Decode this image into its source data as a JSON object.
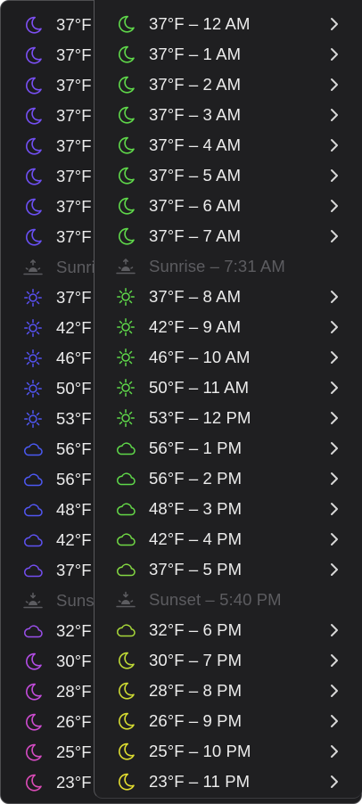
{
  "menu_back": {
    "rows": [
      {
        "icon": "moon-icon",
        "color": "#7d4ff2",
        "label": "37°F",
        "chevron": false,
        "info": false
      },
      {
        "icon": "moon-icon",
        "color": "#7a4ff2",
        "label": "37°F",
        "chevron": false,
        "info": false
      },
      {
        "icon": "moon-icon",
        "color": "#774ff2",
        "label": "37°F",
        "chevron": false,
        "info": false
      },
      {
        "icon": "moon-icon",
        "color": "#744ff2",
        "label": "37°F",
        "chevron": false,
        "info": false
      },
      {
        "icon": "moon-icon",
        "color": "#714ff2",
        "label": "37°F",
        "chevron": false,
        "info": false
      },
      {
        "icon": "moon-icon",
        "color": "#6e4ff2",
        "label": "37°F",
        "chevron": false,
        "info": false
      },
      {
        "icon": "moon-icon",
        "color": "#6b4ff2",
        "label": "37°F",
        "chevron": false,
        "info": false
      },
      {
        "icon": "moon-icon",
        "color": "#684ff2",
        "label": "37°F",
        "chevron": false,
        "info": false
      },
      {
        "icon": "sunrise-icon",
        "color": "#5c5c60",
        "label": "Sunris",
        "chevron": false,
        "info": true
      },
      {
        "icon": "sun-icon",
        "color": "#5a50f2",
        "label": "37°F",
        "chevron": false,
        "info": false
      },
      {
        "icon": "sun-icon",
        "color": "#5752f2",
        "label": "42°F",
        "chevron": false,
        "info": false
      },
      {
        "icon": "sun-icon",
        "color": "#5453f2",
        "label": "46°F",
        "chevron": false,
        "info": false
      },
      {
        "icon": "sun-icon",
        "color": "#5155f2",
        "label": "50°F",
        "chevron": false,
        "info": false
      },
      {
        "icon": "sun-icon",
        "color": "#4f57f2",
        "label": "53°F",
        "chevron": false,
        "info": false
      },
      {
        "icon": "cloud-icon",
        "color": "#4a59f2",
        "label": "56°F",
        "chevron": false,
        "info": false
      },
      {
        "icon": "cloud-icon",
        "color": "#4d58f2",
        "label": "56°F",
        "chevron": false,
        "info": false
      },
      {
        "icon": "cloud-icon",
        "color": "#5256f2",
        "label": "48°F",
        "chevron": false,
        "info": false
      },
      {
        "icon": "cloud-icon",
        "color": "#5e52f2",
        "label": "42°F",
        "chevron": false,
        "info": false
      },
      {
        "icon": "cloud-icon",
        "color": "#744ef0",
        "label": "37°F",
        "chevron": false,
        "info": false
      },
      {
        "icon": "sunset-icon",
        "color": "#5c5c60",
        "label": "Suns",
        "chevron": false,
        "info": true
      },
      {
        "icon": "cloud-icon",
        "color": "#9a4fea",
        "label": "32°F",
        "chevron": false,
        "info": false
      },
      {
        "icon": "moon-icon",
        "color": "#b24ce4",
        "label": "30°F",
        "chevron": false,
        "info": false
      },
      {
        "icon": "moon-icon",
        "color": "#c24bda",
        "label": "28°F",
        "chevron": false,
        "info": false
      },
      {
        "icon": "moon-icon",
        "color": "#cc4bce",
        "label": "26°F",
        "chevron": false,
        "info": false
      },
      {
        "icon": "moon-icon",
        "color": "#d44bc2",
        "label": "25°F",
        "chevron": false,
        "info": false
      },
      {
        "icon": "moon-icon",
        "color": "#da4bb6",
        "label": "23°F",
        "chevron": false,
        "info": false
      }
    ]
  },
  "menu_front": {
    "rows": [
      {
        "icon": "moon-icon",
        "color": "#5fd84a",
        "label": "37°F – 12 AM",
        "chevron": true,
        "info": false
      },
      {
        "icon": "moon-icon",
        "color": "#5fd84a",
        "label": "37°F – 1 AM",
        "chevron": true,
        "info": false
      },
      {
        "icon": "moon-icon",
        "color": "#5fd84a",
        "label": "37°F – 2 AM",
        "chevron": true,
        "info": false
      },
      {
        "icon": "moon-icon",
        "color": "#5fd84a",
        "label": "37°F – 3 AM",
        "chevron": true,
        "info": false
      },
      {
        "icon": "moon-icon",
        "color": "#5fd84a",
        "label": "37°F – 4 AM",
        "chevron": true,
        "info": false
      },
      {
        "icon": "moon-icon",
        "color": "#5fd84a",
        "label": "37°F – 5 AM",
        "chevron": true,
        "info": false
      },
      {
        "icon": "moon-icon",
        "color": "#5fd84a",
        "label": "37°F – 6 AM",
        "chevron": true,
        "info": false
      },
      {
        "icon": "moon-icon",
        "color": "#5fd84a",
        "label": "37°F – 7 AM",
        "chevron": true,
        "info": false
      },
      {
        "icon": "sunrise-icon",
        "color": "#5c5c60",
        "label": "Sunrise – 7:31 AM",
        "chevron": false,
        "info": true
      },
      {
        "icon": "sun-icon",
        "color": "#5fd84a",
        "label": "37°F – 8 AM",
        "chevron": true,
        "info": false
      },
      {
        "icon": "sun-icon",
        "color": "#5fd84a",
        "label": "42°F – 9 AM",
        "chevron": true,
        "info": false
      },
      {
        "icon": "sun-icon",
        "color": "#5fd84a",
        "label": "46°F – 10 AM",
        "chevron": true,
        "info": false
      },
      {
        "icon": "sun-icon",
        "color": "#5fd84a",
        "label": "50°F – 11 AM",
        "chevron": true,
        "info": false
      },
      {
        "icon": "sun-icon",
        "color": "#5fd84a",
        "label": "53°F – 12 PM",
        "chevron": true,
        "info": false
      },
      {
        "icon": "cloud-icon",
        "color": "#5fd84a",
        "label": "56°F – 1 PM",
        "chevron": true,
        "info": false
      },
      {
        "icon": "cloud-icon",
        "color": "#5fd84a",
        "label": "56°F – 2 PM",
        "chevron": true,
        "info": false
      },
      {
        "icon": "cloud-icon",
        "color": "#65d848",
        "label": "48°F – 3 PM",
        "chevron": true,
        "info": false
      },
      {
        "icon": "cloud-icon",
        "color": "#70d845",
        "label": "42°F – 4 PM",
        "chevron": true,
        "info": false
      },
      {
        "icon": "cloud-icon",
        "color": "#84d843",
        "label": "37°F – 5 PM",
        "chevron": true,
        "info": false
      },
      {
        "icon": "sunset-icon",
        "color": "#5c5c60",
        "label": "Sunset – 5:40 PM",
        "chevron": false,
        "info": true
      },
      {
        "icon": "cloud-icon",
        "color": "#a8d83a",
        "label": "32°F – 6 PM",
        "chevron": true,
        "info": false
      },
      {
        "icon": "moon-icon",
        "color": "#bed836",
        "label": "30°F – 7 PM",
        "chevron": true,
        "info": false
      },
      {
        "icon": "moon-icon",
        "color": "#cbd833",
        "label": "28°F – 8 PM",
        "chevron": true,
        "info": false
      },
      {
        "icon": "moon-icon",
        "color": "#d4da32",
        "label": "26°F – 9 PM",
        "chevron": true,
        "info": false
      },
      {
        "icon": "moon-icon",
        "color": "#dcdc31",
        "label": "25°F – 10 PM",
        "chevron": true,
        "info": false
      },
      {
        "icon": "moon-icon",
        "color": "#e2dc30",
        "label": "23°F – 11 PM",
        "chevron": true,
        "info": false
      }
    ]
  },
  "colors": {
    "menu_background": "#1f1f21",
    "text": "#ececec",
    "disabled_text": "#5c5c60",
    "chevron": "#d8d8d8"
  }
}
